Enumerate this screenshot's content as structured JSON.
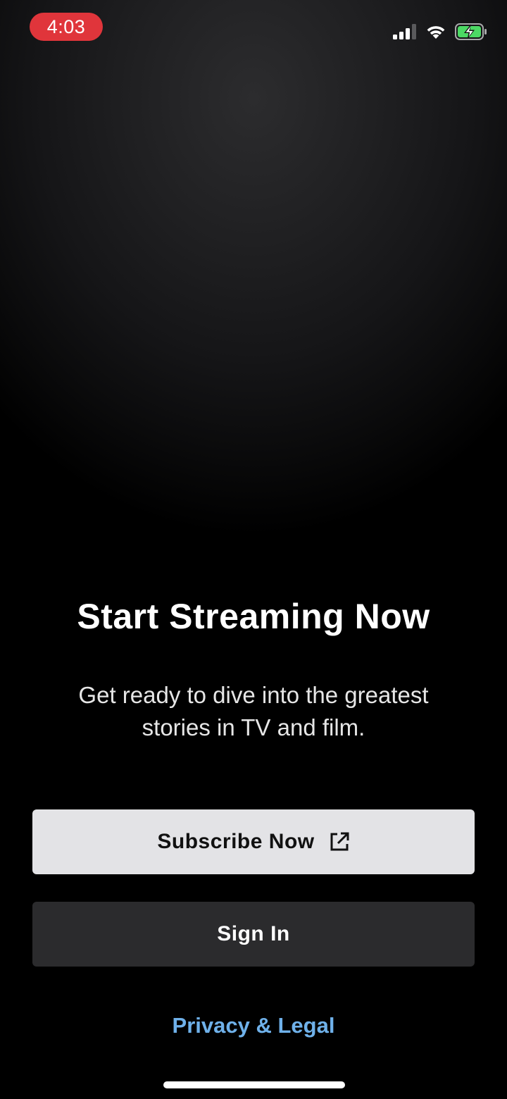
{
  "status_bar": {
    "time": "4:03",
    "time_pill_color": "#e0353b",
    "icons": [
      "cellular-signal-icon",
      "wifi-icon",
      "battery-charging-icon"
    ],
    "battery_color": "#4cd964"
  },
  "hero": {
    "title": "Start Streaming Now",
    "subtitle": "Get ready to dive into the greatest stories in TV and film."
  },
  "actions": {
    "subscribe_label": "Subscribe Now",
    "subscribe_icon": "external-link-icon",
    "signin_label": "Sign In"
  },
  "footer": {
    "privacy_link": "Privacy & Legal",
    "link_color": "#6fb1ea"
  }
}
